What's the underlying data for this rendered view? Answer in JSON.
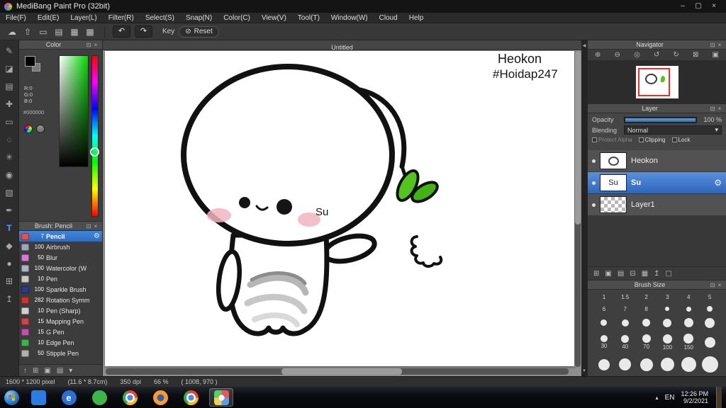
{
  "window": {
    "title": "MediBang Paint Pro (32bit)",
    "controls": {
      "minimize": "–",
      "maximize": "▢",
      "close": "×"
    },
    "menu_items": [
      "File(F)",
      "Edit(E)",
      "Layer(L)",
      "Filter(R)",
      "Select(S)",
      "Snap(N)",
      "Color(C)",
      "View(V)",
      "Tool(T)",
      "Window(W)",
      "Cloud",
      "Help"
    ]
  },
  "panel_chrome": {
    "popout": "⊡",
    "close": "×"
  },
  "toolbar": {
    "icons": [
      {
        "glyph": "☁",
        "name": "cloud-icon"
      },
      {
        "glyph": "⇧",
        "name": "upload-icon"
      },
      {
        "glyph": "▭",
        "name": "comment-icon"
      },
      {
        "glyph": "▤",
        "name": "document-icon"
      },
      {
        "glyph": "▦",
        "name": "panel-layout-icon"
      },
      {
        "glyph": "▩",
        "name": "panel-grid-icon"
      }
    ],
    "undo_glyph": "↶",
    "redo_glyph": "↷",
    "key_label": "Key",
    "reset_glyph": "⊘",
    "reset_label": "Reset"
  },
  "tools": [
    {
      "glyph": "✎",
      "name": "pen-tool"
    },
    {
      "glyph": "◪",
      "name": "eraser-tool"
    },
    {
      "glyph": "▤",
      "name": "brush-tool"
    },
    {
      "glyph": "✚",
      "name": "move-tool"
    },
    {
      "glyph": "▭",
      "name": "select-rect-tool"
    },
    {
      "glyph": "◌",
      "name": "lasso-tool"
    },
    {
      "glyph": "✳",
      "name": "magic-wand-tool"
    },
    {
      "glyph": "◉",
      "name": "bucket-tool"
    },
    {
      "glyph": "▧",
      "name": "gradient-tool"
    },
    {
      "glyph": "✒",
      "name": "select-pen-tool"
    },
    {
      "glyph": "T",
      "name": "text-tool",
      "active": true
    },
    {
      "glyph": "◆",
      "name": "eyedropper-tool"
    },
    {
      "glyph": "●",
      "name": "hand-tool"
    },
    {
      "glyph": "⊞",
      "name": "divide-tool"
    },
    {
      "glyph": "↥",
      "name": "panel-toggle-tool"
    }
  ],
  "color_panel": {
    "title": "Color",
    "r": "R:0",
    "g": "G:0",
    "b": "B:0",
    "hex": "#000000"
  },
  "brush_panel": {
    "title": "Brush: Pencil",
    "brushes": [
      {
        "size": "7",
        "name": "Pencil",
        "color": "#e05252",
        "selected": true
      },
      {
        "size": "100",
        "name": "Airbrush",
        "color": "#9aa7b8"
      },
      {
        "size": "50",
        "name": "Blur",
        "color": "#d678d6"
      },
      {
        "size": "100",
        "name": "Watercolor (W",
        "color": "#aab6c0"
      },
      {
        "size": "10",
        "name": "Pen",
        "color": "#c8c8c8"
      },
      {
        "size": "100",
        "name": "Sparkle Brush",
        "color": "#2a3a8c"
      },
      {
        "size": "282",
        "name": "Rotation Symm",
        "color": "#cc3333"
      },
      {
        "size": "10",
        "name": "Pen (Sharp)",
        "color": "#d0d0d0"
      },
      {
        "size": "15",
        "name": "Mapping Pen",
        "color": "#cc4444"
      },
      {
        "size": "15",
        "name": "G Pen",
        "color": "#c84db0"
      },
      {
        "size": "10",
        "name": "Edge Pen",
        "color": "#39b54a"
      },
      {
        "size": "50",
        "name": "Stipple Pen",
        "color": "#b0b0b0"
      }
    ],
    "footer_icons": [
      {
        "glyph": "↑",
        "name": "scroll-up-icon"
      },
      {
        "glyph": "⊞",
        "name": "add-brush-icon"
      },
      {
        "glyph": "▣",
        "name": "duplicate-brush-icon"
      },
      {
        "glyph": "▤",
        "name": "edit-brush-icon"
      },
      {
        "glyph": "▾",
        "name": "more-icon"
      }
    ]
  },
  "canvas": {
    "tab_title": "Untitled",
    "annotation_line1": "Heokon",
    "annotation_line2": "#Hoidap247",
    "label_su": "Su"
  },
  "navigator": {
    "title": "Navigator",
    "icons": [
      {
        "glyph": "⊕",
        "name": "zoom-in-icon"
      },
      {
        "glyph": "⊖",
        "name": "zoom-out-icon"
      },
      {
        "glyph": "◎",
        "name": "zoom-fit-icon"
      },
      {
        "glyph": "↺",
        "name": "rotate-ccw-icon"
      },
      {
        "glyph": "↻",
        "name": "rotate-cw-icon"
      },
      {
        "glyph": "⊠",
        "name": "flip-icon"
      },
      {
        "glyph": "▣",
        "name": "actual-pixels-icon"
      }
    ]
  },
  "layer_panel": {
    "title": "Layer",
    "opacity_label": "Opacity",
    "opacity_value": "100 %",
    "blending_label": "Blending",
    "blending_value": "Normal",
    "dropdown_arrow": "▾",
    "protect_alpha": "Protect Alpha",
    "clipping": "Clipping",
    "lock": "Lock",
    "layers": [
      {
        "name": "Heokon",
        "doodle": true
      },
      {
        "name": "Su",
        "selected": true,
        "thumb_text": "Su"
      },
      {
        "name": "Layer1",
        "checker": true
      }
    ],
    "footer_icons": [
      {
        "glyph": "⊞",
        "name": "add-layer-icon"
      },
      {
        "glyph": "▣",
        "name": "add-folder-icon"
      },
      {
        "glyph": "▤",
        "name": "duplicate-layer-icon"
      },
      {
        "glyph": "⊟",
        "name": "merge-layer-icon"
      },
      {
        "glyph": "▦",
        "name": "layer-effect-icon"
      },
      {
        "glyph": "↥",
        "name": "move-layer-icon"
      },
      {
        "glyph": "▢",
        "name": "trash-icon"
      }
    ]
  },
  "brush_size_panel": {
    "title": "Brush Size",
    "cells": [
      {
        "t": "1"
      },
      {
        "t": "1.5"
      },
      {
        "t": "2"
      },
      {
        "t": "3"
      },
      {
        "t": "4"
      },
      {
        "t": "5"
      },
      {
        "t": "6"
      },
      {
        "t": "7"
      },
      {
        "t": "8"
      },
      {
        "d": 6
      },
      {
        "d": 7
      },
      {
        "d": 8
      },
      {
        "d": 9
      },
      {
        "d": 10
      },
      {
        "d": 11
      },
      {
        "d": 12
      },
      {
        "d": 13
      },
      {
        "d": 14
      },
      {
        "d": 10,
        "t": "30"
      },
      {
        "d": 11,
        "t": "40"
      },
      {
        "d": 12,
        "t": "70"
      },
      {
        "d": 13,
        "t": "100"
      },
      {
        "d": 14,
        "t": "150"
      },
      {
        "d": 15
      },
      {
        "d": 16
      },
      {
        "d": 17
      },
      {
        "d": 18
      },
      {
        "d": 19
      },
      {
        "d": 21
      },
      {
        "d": 23
      }
    ]
  },
  "status_bar": {
    "size": "1600 * 1200 pixel",
    "cm": "(11.6 * 8.7cm)",
    "dpi": "350 dpi",
    "zoom": "66 %",
    "coords": "( 1008, 970 )"
  },
  "taskbar": {
    "apps": [
      {
        "name": "taskbar-media-player",
        "color": "#2b7de0",
        "round": false
      },
      {
        "name": "taskbar-internet-explorer",
        "color": "#2b6fd4",
        "glyph": "e",
        "round": true
      },
      {
        "name": "taskbar-coccoc-browser",
        "color": "#3db54a",
        "round": true
      },
      {
        "name": "taskbar-chrome",
        "chrome": true
      },
      {
        "name": "taskbar-firefox",
        "firefox": true
      },
      {
        "name": "taskbar-chrome-2",
        "chrome": true
      },
      {
        "name": "taskbar-medibang",
        "medibang": true,
        "active": true
      }
    ],
    "tray": {
      "chevron": "▴",
      "lang": "EN",
      "time": "12:26 PM",
      "date": "9/2/2021"
    }
  }
}
